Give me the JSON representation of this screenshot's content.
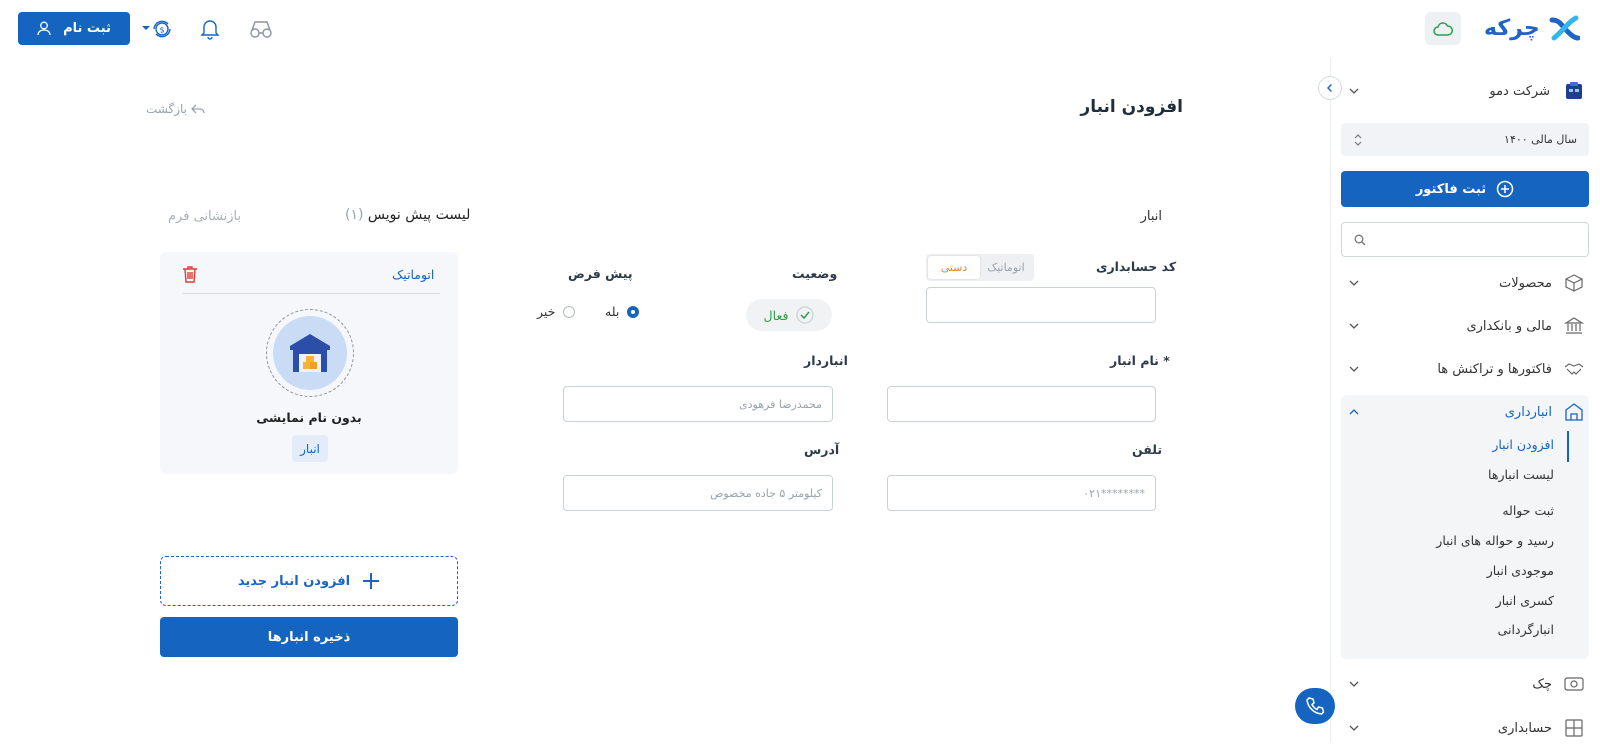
{
  "topbar": {
    "signup_label": "ثبت نام",
    "icons": [
      "user-icon",
      "coin-exchange-icon",
      "bell-icon",
      "glasses-icon",
      "cloud-icon"
    ]
  },
  "brand": {
    "name": "چرکه",
    "color": "#1e63c6"
  },
  "sidebar": {
    "company": "شرکت دمو",
    "fiscal_year": "سال مالی ۱۴۰۰",
    "invoice_button": "ثبت فاکتور",
    "search_placeholder": "",
    "items": [
      {
        "label": "محصولات",
        "icon": "box-icon"
      },
      {
        "label": "مالی و بانکداری",
        "icon": "bank-icon"
      },
      {
        "label": "فاکتورها و تراکنش ها",
        "icon": "handshake-icon"
      },
      {
        "label": "انبارداری",
        "icon": "warehouse-icon",
        "active": true
      },
      {
        "label": "چک",
        "icon": "cheque-icon"
      },
      {
        "label": "حسابداری",
        "icon": "calculator-icon"
      }
    ],
    "sub_items": [
      {
        "label": "افزودن انبار",
        "active": true
      },
      {
        "label": "لیست انبارها"
      },
      {
        "label": "ثبت حواله"
      },
      {
        "label": "رسید و حواله های انبار"
      },
      {
        "label": "موجودی انبار"
      },
      {
        "label": "کسری انبار"
      },
      {
        "label": "انبارگردانی"
      }
    ]
  },
  "main": {
    "title": "افزودن انبار",
    "back": "بازگشت",
    "section": "انبار",
    "draft_list": "لیست پیش نویس",
    "draft_count": "(۱)",
    "reset": "بازنشانی فرم",
    "form": {
      "accounting_code_label": "کد حسابداری",
      "code_mode": {
        "auto": "اتوماتیک",
        "manual": "دستی",
        "selected": "manual"
      },
      "accounting_code_value": "",
      "status_label": "وضعیت",
      "status_value": "فعال",
      "default_label": "پیش فرض",
      "default_yes": "بله",
      "default_no": "خیر",
      "default_selected": "yes",
      "name_label": "نام انبار *",
      "name_value": "",
      "keeper_label": "انباردار",
      "keeper_placeholder": "محمدرضا فرهودی",
      "phone_label": "تلفن",
      "phone_placeholder": "۰۲۱********",
      "address_label": "آدرس",
      "address_placeholder": "کیلومتر ۵ جاده مخصوص"
    },
    "card": {
      "mode": "اتوماتیک",
      "name": "بدون نام نمایشی",
      "tag": "انبار"
    },
    "add_new": "افزودن انبار جدید",
    "save": "ذخیره انبارها"
  },
  "colors": {
    "primary": "#1565c0",
    "success": "#2e9d48",
    "orange": "#e8832a"
  }
}
